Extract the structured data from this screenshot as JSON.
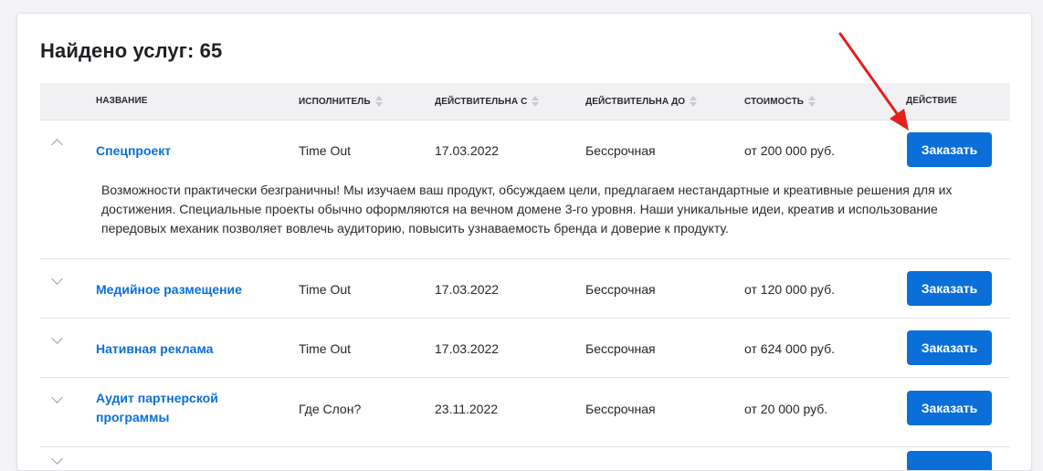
{
  "title": "Найдено услуг: 65",
  "columns": {
    "name": "Название",
    "performer": "Исполнитель",
    "valid_from": "Действительна с",
    "valid_to": "Действительна до",
    "cost": "Стоимость",
    "action": "Действие"
  },
  "rows": [
    {
      "name": "Спецпроект",
      "performer": "Time Out",
      "valid_from": "17.03.2022",
      "valid_to": "Бессрочная",
      "cost": "от 200 000 руб.",
      "button": "Заказать",
      "expanded": true,
      "description": "Возможности практически безграничны! Мы изучаем ваш продукт, обсуждаем цели, предлагаем нестандартные и креативные решения для их достижения. Специальные проекты обычно оформляются на вечном домене 3-го уровня. Наши уникальные идеи, креатив и использование передовых механик позволяет вовлечь аудиторию, повысить узнаваемость бренда и доверие к продукту."
    },
    {
      "name": "Медийное размещение",
      "performer": "Time Out",
      "valid_from": "17.03.2022",
      "valid_to": "Бессрочная",
      "cost": "от 120 000 руб.",
      "button": "Заказать",
      "expanded": false
    },
    {
      "name": "Нативная реклама",
      "performer": "Time Out",
      "valid_from": "17.03.2022",
      "valid_to": "Бессрочная",
      "cost": "от 624 000 руб.",
      "button": "Заказать",
      "expanded": false
    },
    {
      "name": "Аудит партнерской программы",
      "performer": "Где Слон?",
      "valid_from": "23.11.2022",
      "valid_to": "Бессрочная",
      "cost": "от 20 000 руб.",
      "button": "Заказать",
      "expanded": false
    }
  ],
  "colors": {
    "accent": "#0a6fd8",
    "annotation_arrow": "#e3201b"
  },
  "icons": {
    "sort": "sort-arrows-icon",
    "collapse": "chevron-up-icon",
    "expand": "chevron-down-icon",
    "annotation": "red-arrow-icon"
  }
}
